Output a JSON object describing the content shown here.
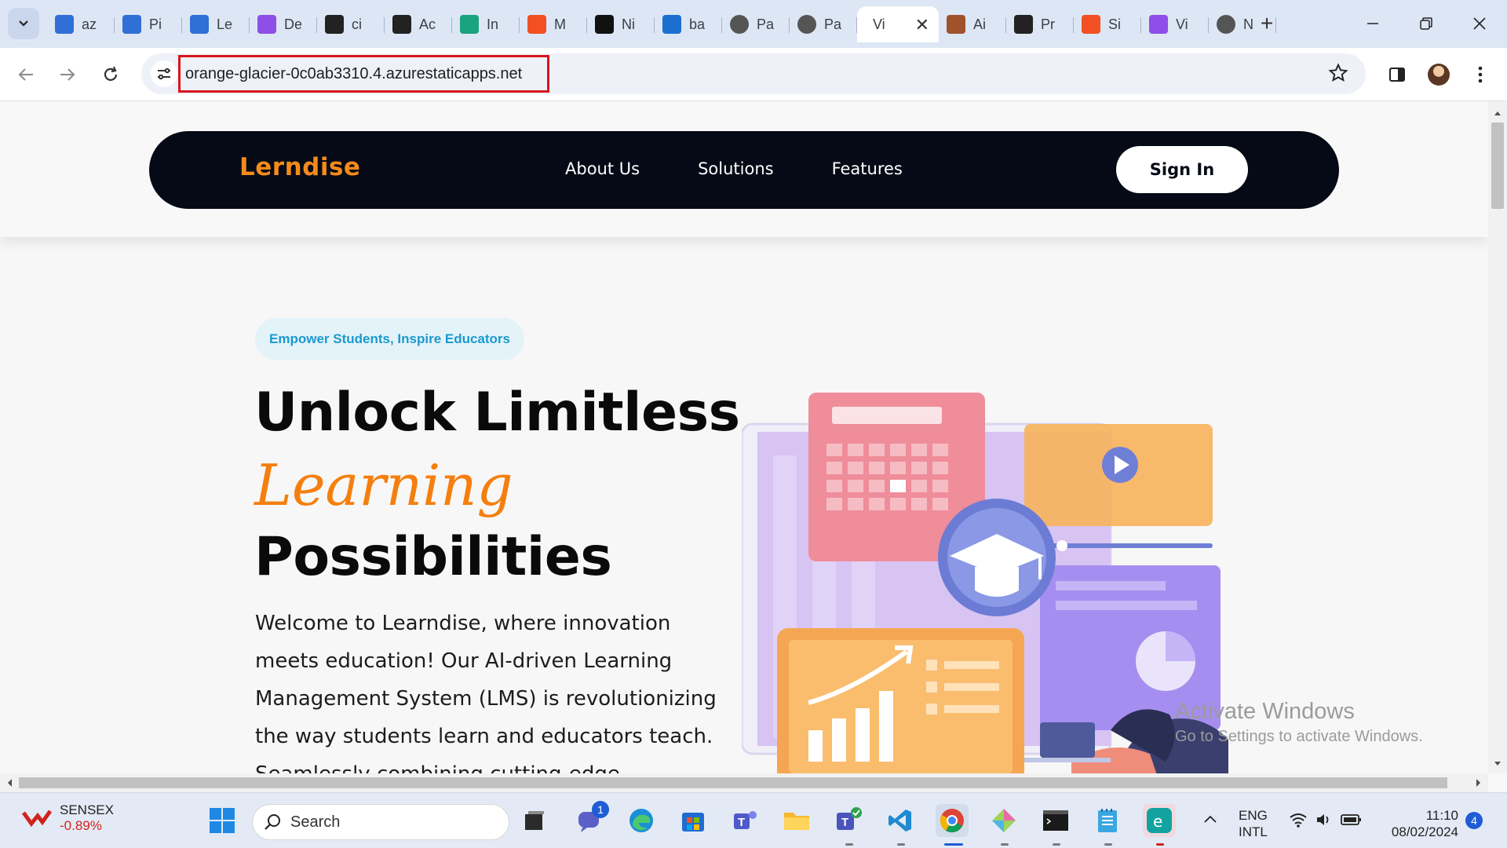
{
  "browser": {
    "tabs": [
      {
        "title": "az",
        "icon": "azure-devops-icon",
        "color": "#2f6fd6"
      },
      {
        "title": "Pi",
        "icon": "azure-devops-icon",
        "color": "#2f6fd6"
      },
      {
        "title": "Le",
        "icon": "azure-devops-icon",
        "color": "#2f6fd6"
      },
      {
        "title": "De",
        "icon": "vite-icon",
        "color": "#8d4fe8"
      },
      {
        "title": "ci",
        "icon": "github-icon",
        "color": "#222222"
      },
      {
        "title": "Ac",
        "icon": "github-icon",
        "color": "#222222"
      },
      {
        "title": "In",
        "icon": "chatgpt-icon",
        "color": "#19a37f"
      },
      {
        "title": "M",
        "icon": "microsoft-icon",
        "color": "#f25022"
      },
      {
        "title": "Ni",
        "icon": "hot-icon",
        "color": "#111111"
      },
      {
        "title": "ba",
        "icon": "azure-icon",
        "color": "#1b6fd1"
      },
      {
        "title": "Pa",
        "icon": "globe-icon",
        "color": "#555555"
      },
      {
        "title": "Pa",
        "icon": "globe-icon",
        "color": "#555555"
      },
      {
        "title": "Vi",
        "icon": "blank-icon",
        "color": "#ffffff",
        "active": true
      },
      {
        "title": "Ai",
        "icon": "avatar-icon",
        "color": "#a0522d"
      },
      {
        "title": "Pr",
        "icon": "apps-icon",
        "color": "#222222"
      },
      {
        "title": "Si",
        "icon": "microsoft-icon",
        "color": "#f25022"
      },
      {
        "title": "Vi",
        "icon": "vite-icon",
        "color": "#8d4fe8"
      },
      {
        "title": "N",
        "icon": "globe-icon",
        "color": "#555555"
      }
    ],
    "url": "orange-glacier-0c0ab3310.4.azurestaticapps.net"
  },
  "site": {
    "brand": "Lerndise",
    "nav": [
      "About Us",
      "Solutions",
      "Features"
    ],
    "signin": "Sign In",
    "tagline": "Empower Students, Inspire Educators",
    "title_line1": "Unlock Limitless",
    "title_accent": "Learning",
    "title_line3": "Possibilities",
    "intro": "Welcome to Learndise, where innovation meets education! Our AI-driven Learning Management System (LMS) is revolutionizing the way students learn and educators teach. Seamlessly combining cutting-edge technology with a user - friendly"
  },
  "watermark": {
    "line1": "Activate Windows",
    "line2": "Go to Settings to activate Windows."
  },
  "taskbar": {
    "sensex_label": "SENSEX",
    "sensex_change": "-0.89%",
    "search_label": "Search",
    "lang_line1": "ENG",
    "lang_line2": "INTL",
    "time": "11:10",
    "date": "08/02/2024",
    "notification_count": "4",
    "chat_badge": "1"
  },
  "colors": {
    "brand_orange": "#f58a1a",
    "navbar_bg": "#050a16",
    "tagline_text": "#1a9ad0",
    "url_highlight": "#d9141b"
  }
}
